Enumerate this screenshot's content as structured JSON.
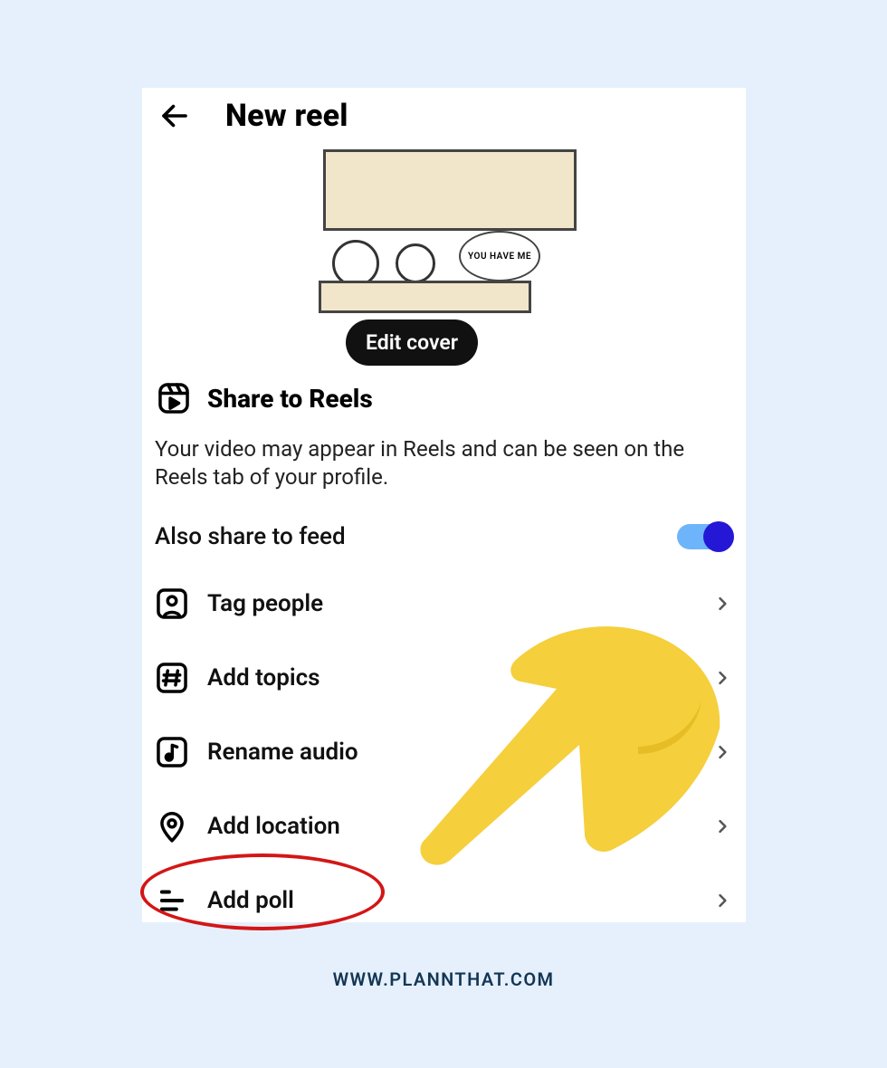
{
  "header": {
    "title": "New reel"
  },
  "cover": {
    "bubble_text": "YOU HAVE ME",
    "edit_label": "Edit cover"
  },
  "share": {
    "title": "Share to Reels",
    "description": "Your video may appear in Reels and can be seen on the Reels tab of your profile."
  },
  "feed": {
    "label": "Also share to feed",
    "enabled": true
  },
  "options": [
    {
      "key": "tag-people",
      "label": "Tag people"
    },
    {
      "key": "add-topics",
      "label": "Add topics"
    },
    {
      "key": "rename-audio",
      "label": "Rename audio"
    },
    {
      "key": "add-location",
      "label": "Add location"
    },
    {
      "key": "add-poll",
      "label": "Add poll"
    }
  ],
  "footer": {
    "url": "WWW.PLANNTHAT.COM"
  }
}
